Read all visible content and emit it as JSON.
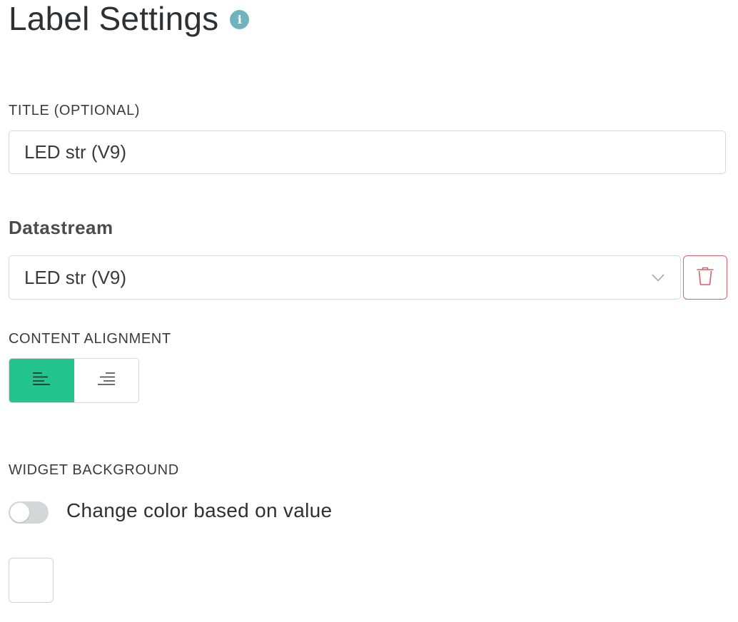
{
  "header": {
    "title": "Label Settings",
    "info_icon": "info-icon",
    "info_glyph": "i"
  },
  "title_field": {
    "label": "TITLE (OPTIONAL)",
    "value": "LED str (V9)"
  },
  "datastream": {
    "heading": "Datastream",
    "selected_value": "LED str (V9)",
    "dropdown_icon": "chevron-down-icon",
    "delete_icon": "trash-icon"
  },
  "content_alignment": {
    "label": "CONTENT ALIGNMENT",
    "options": [
      {
        "name": "align-left",
        "icon": "align-left-icon",
        "active": true
      },
      {
        "name": "align-right",
        "icon": "align-right-icon",
        "active": false
      }
    ]
  },
  "widget_background": {
    "label": "WIDGET BACKGROUND",
    "toggle_label": "Change color based on value",
    "toggle_on": false,
    "swatch_color": "#ffffff"
  },
  "colors": {
    "accent": "#23c48e",
    "danger": "#d9616a",
    "info": "#6fb3bf",
    "border": "#d6d8db"
  }
}
